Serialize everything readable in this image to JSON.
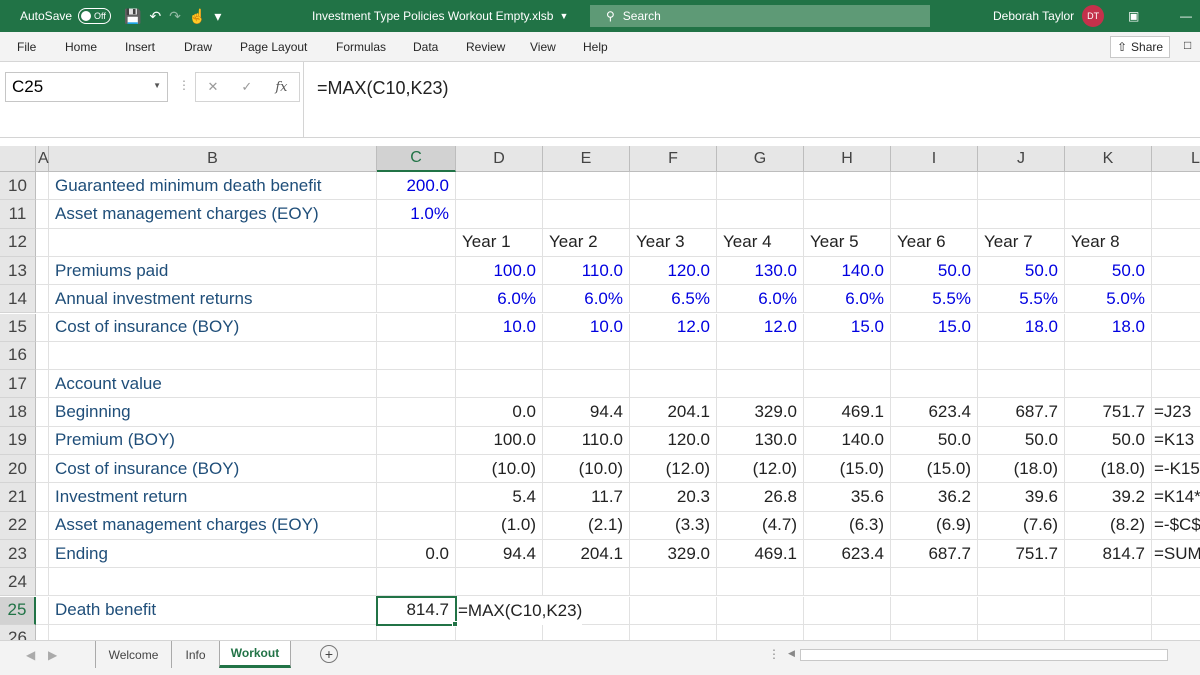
{
  "titlebar": {
    "autosave_label": "AutoSave",
    "autosave_state": "Off",
    "filename": "Investment Type Policies Workout Empty.xlsb",
    "search_placeholder": "Search",
    "user_name": "Deborah Taylor",
    "user_initials": "DT",
    "accent_color": "#217346"
  },
  "ribbon": {
    "tabs": [
      "File",
      "Home",
      "Insert",
      "Draw",
      "Page Layout",
      "Formulas",
      "Data",
      "Review",
      "View",
      "Help"
    ],
    "share_label": "Share"
  },
  "formula_bar": {
    "name_box": "C25",
    "formula": "=MAX(C10,K23)"
  },
  "columns": [
    "A",
    "B",
    "C",
    "D",
    "E",
    "F",
    "G",
    "H",
    "I",
    "J",
    "K",
    "L"
  ],
  "selected_column": "C",
  "selected_row": "25",
  "rows": [
    {
      "num": "10",
      "label": "Guaranteed minimum death benefit",
      "c": "200.0",
      "c_input": true,
      "vals": []
    },
    {
      "num": "11",
      "label": "Asset management charges (EOY)",
      "c": "1.0%",
      "c_input": true,
      "vals": []
    },
    {
      "num": "12",
      "label": "",
      "c": "",
      "header": true,
      "vals": [
        "Year 1",
        "Year 2",
        "Year 3",
        "Year 4",
        "Year 5",
        "Year 6",
        "Year 7",
        "Year 8"
      ]
    },
    {
      "num": "13",
      "label": "Premiums paid",
      "c": "",
      "input": true,
      "vals": [
        "100.0",
        "110.0",
        "120.0",
        "130.0",
        "140.0",
        "50.0",
        "50.0",
        "50.0"
      ]
    },
    {
      "num": "14",
      "label": "Annual investment returns",
      "c": "",
      "input": true,
      "vals": [
        "6.0%",
        "6.0%",
        "6.5%",
        "6.0%",
        "6.0%",
        "5.5%",
        "5.5%",
        "5.0%"
      ]
    },
    {
      "num": "15",
      "label": "Cost of insurance (BOY)",
      "c": "",
      "input": true,
      "vals": [
        "10.0",
        "10.0",
        "12.0",
        "12.0",
        "15.0",
        "15.0",
        "18.0",
        "18.0"
      ]
    },
    {
      "num": "16",
      "label": "",
      "c": "",
      "vals": []
    },
    {
      "num": "17",
      "label": "Account value",
      "c": "",
      "vals": []
    },
    {
      "num": "18",
      "label": "Beginning",
      "c": "",
      "vals": [
        "0.0",
        "94.4",
        "204.1",
        "329.0",
        "469.1",
        "623.4",
        "687.7",
        "751.7"
      ],
      "trail": "=J23"
    },
    {
      "num": "19",
      "label": "Premium (BOY)",
      "c": "",
      "vals": [
        "100.0",
        "110.0",
        "120.0",
        "130.0",
        "140.0",
        "50.0",
        "50.0",
        "50.0"
      ],
      "trail": "=K13"
    },
    {
      "num": "20",
      "label": "Cost of insurance (BOY)",
      "c": "",
      "vals": [
        "(10.0)",
        "(10.0)",
        "(12.0)",
        "(12.0)",
        "(15.0)",
        "(15.0)",
        "(18.0)",
        "(18.0)"
      ],
      "trail": "=-K15"
    },
    {
      "num": "21",
      "label": "Investment return",
      "c": "",
      "vals": [
        "5.4",
        "11.7",
        "20.3",
        "26.8",
        "35.6",
        "36.2",
        "39.6",
        "39.2"
      ],
      "trail": "=K14*"
    },
    {
      "num": "22",
      "label": "Asset management charges (EOY)",
      "c": "",
      "vals": [
        "(1.0)",
        "(2.1)",
        "(3.3)",
        "(4.7)",
        "(6.3)",
        "(6.9)",
        "(7.6)",
        "(8.2)"
      ],
      "trail": "=-$C$"
    },
    {
      "num": "23",
      "label": "Ending",
      "c": "0.0",
      "vals": [
        "94.4",
        "204.1",
        "329.0",
        "469.1",
        "623.4",
        "687.7",
        "751.7",
        "814.7"
      ],
      "trail": "=SUM"
    },
    {
      "num": "24",
      "label": "",
      "c": "",
      "vals": []
    },
    {
      "num": "25",
      "label": "Death benefit",
      "c": "814.7",
      "vals": [],
      "trail_d": "=MAX(C10,K23)"
    },
    {
      "num": "26",
      "label": "",
      "c": "",
      "vals": []
    }
  ],
  "sheet_tabs": [
    "Welcome",
    "Info",
    "Workout"
  ],
  "active_sheet": "Workout"
}
